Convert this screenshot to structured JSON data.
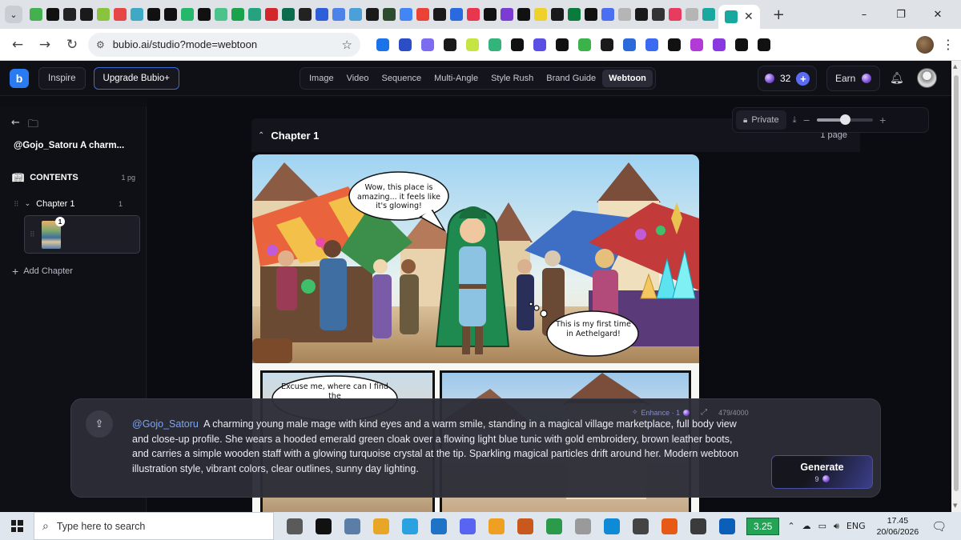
{
  "browser": {
    "url": "bubio.ai/studio?mode=webtoon",
    "tab_favicon_colors": [
      "#44b04f",
      "#111111",
      "#222222",
      "#1a1a1a",
      "#8ac43f",
      "#e64646",
      "#3fa8c5",
      "#111111",
      "#111111",
      "#25b86b",
      "#111111",
      "#4cc38a",
      "#1aa34a",
      "#26a37e",
      "#d2262a",
      "#0b6b4a",
      "#222222",
      "#2f5fd8",
      "#4d82e8",
      "#4ca0d8",
      "#1a1a1a",
      "#2d4b2d",
      "#4285f4",
      "#ea4335",
      "#1a1a1a",
      "#2a6adf",
      "#e8364f",
      "#111111",
      "#7a3cd3",
      "#111111",
      "#efd12b",
      "#1a1a1a",
      "#0a7b3d",
      "#111111",
      "#4a6ff0",
      "#b5b5b5",
      "#1a1a1a",
      "#333333",
      "#e73c5d",
      "#b5b5b5",
      "#18a8a0"
    ],
    "extension_colors": [
      "#1a73e8",
      "#2b4ec7",
      "#7b6cf0",
      "#1a1a1a",
      "#c6e542",
      "#34b37a",
      "#111111",
      "#5a4fe2",
      "#111111",
      "#3bb34a",
      "#1a1a1a",
      "#2b6ad8",
      "#3a6bf0",
      "#111111",
      "#b23bd8",
      "#8a38e0",
      "#111111",
      "#111111"
    ]
  },
  "header": {
    "logo_text": "b",
    "inspire": "Inspire",
    "upgrade": "Upgrade Bubio+",
    "modes": [
      "Image",
      "Video",
      "Sequence",
      "Multi-Angle",
      "Style Rush",
      "Brand Guide",
      "Webtoon"
    ],
    "active_mode": "Webtoon",
    "credits": "32",
    "earn": "Earn"
  },
  "sidebar": {
    "project_title": "@Gojo_Satoru  A charm...",
    "contents_label": "CONTENTS",
    "contents_pages": "1 pg",
    "chapter_label": "Chapter 1",
    "chapter_count": "1",
    "page_badge": "1",
    "add_chapter": "Add Chapter"
  },
  "canvas": {
    "chapter_title": "Chapter 1",
    "chapter_pages": "1 page",
    "privacy": "Private",
    "zoom_level": 0.5
  },
  "comic": {
    "bubble1": "Wow, this place is amazing... it feels like it's glowing!",
    "bubble2": "This is my first time in Aethelgard!",
    "bubble3": "Excuse me, where can I find the"
  },
  "prompt": {
    "enhance": "Enhance · 1",
    "char_count": "479/4000",
    "mention": "@Gojo_Satoru",
    "text": "A charming young male mage with kind eyes and a warm smile, standing in a magical village marketplace, full body view and close-up profile. She wears a hooded emerald green cloak over a flowing light blue tunic with gold embroidery, brown leather boots, and carries a simple wooden staff with a glowing turquoise crystal at the tip. Sparkling magical particles drift around her. Modern webtoon illustration style, vibrant colors, clear outlines, sunny day lighting.",
    "generate": "Generate",
    "generate_cost": "9"
  },
  "taskbar": {
    "search_placeholder": "Type here to search",
    "app_colors": [
      "#5a5a5a",
      "#111111",
      "#5a7ea8",
      "#e8a626",
      "#2aa2e2",
      "#1e73c7",
      "#5865f2",
      "#f0a020",
      "#c9581d",
      "#2b9a4a",
      "#9a9a9a",
      "#0f8ad6",
      "#444444",
      "#e65a16",
      "#3b3b3b",
      "#0b5fb8"
    ],
    "battery": "3.25",
    "language": "ENG",
    "time": "17.45",
    "date": "20/06/2026"
  }
}
